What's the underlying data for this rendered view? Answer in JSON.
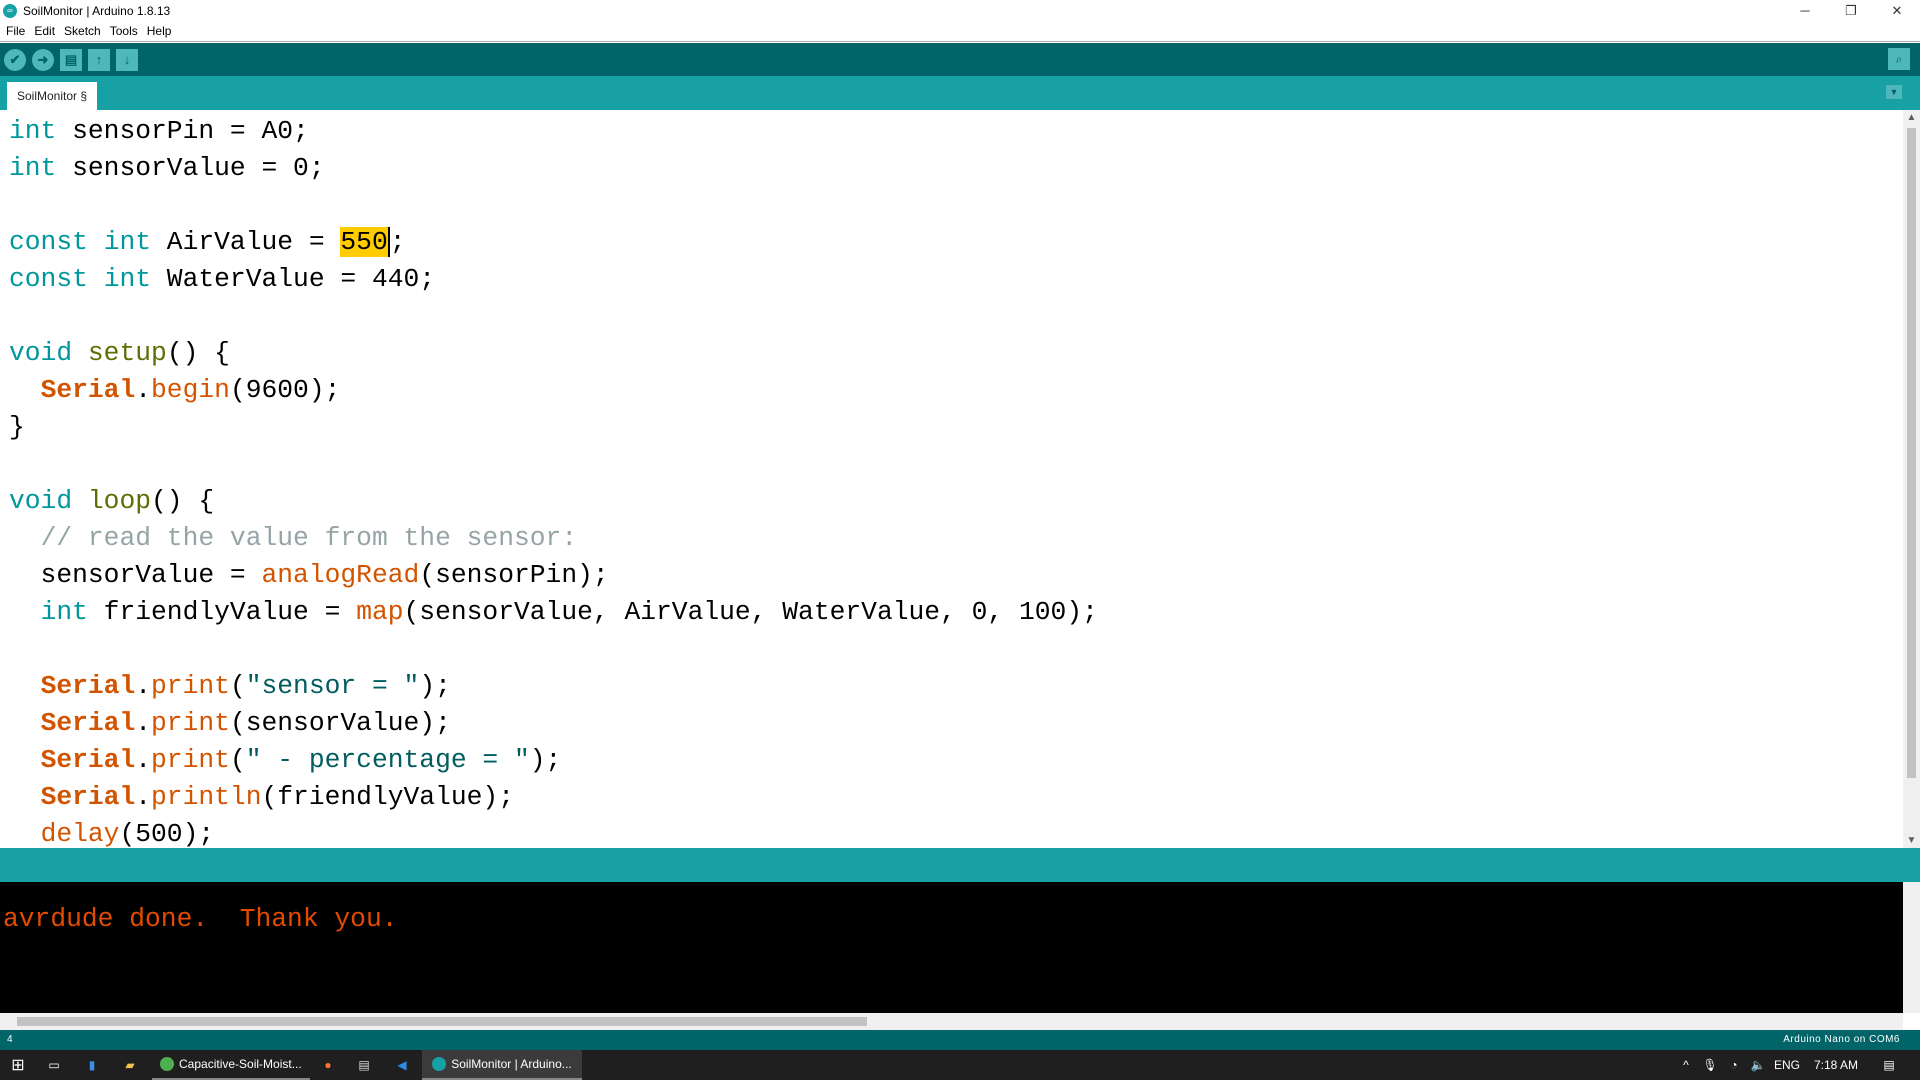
{
  "window": {
    "title": "SoilMonitor | Arduino 1.8.13",
    "controls": [
      "─",
      "❐",
      "✕"
    ]
  },
  "menu": [
    "File",
    "Edit",
    "Sketch",
    "Tools",
    "Help"
  ],
  "toolbar": {
    "buttons": [
      {
        "name": "verify",
        "icon": "✔"
      },
      {
        "name": "upload",
        "icon": "➜"
      },
      {
        "name": "new",
        "icon": "▤"
      },
      {
        "name": "open",
        "icon": "↑"
      },
      {
        "name": "save",
        "icon": "↓"
      }
    ],
    "serial_monitor_icon": "⌕"
  },
  "tab": {
    "label": "SoilMonitor §",
    "menu_icon": "▼"
  },
  "colors": {
    "teal_dark": "#006468",
    "teal": "#17a1a5",
    "keyword": "#00979c",
    "function": "#d35400",
    "string": "#005c5f",
    "comment": "#95a5a6",
    "highlight": "#ffcc00",
    "console_text": "#e34c00"
  },
  "code": [
    [
      [
        "int",
        "kw"
      ],
      [
        " sensorPin = A0;",
        ""
      ]
    ],
    [
      [
        "int",
        "kw"
      ],
      [
        " sensorValue = 0;",
        ""
      ]
    ],
    [],
    [
      [
        "const",
        "kw"
      ],
      [
        " ",
        ""
      ],
      [
        "int",
        "kw"
      ],
      [
        " AirValue = ",
        ""
      ],
      [
        "550",
        "hl caret"
      ],
      [
        ";",
        ""
      ]
    ],
    [
      [
        "const",
        "kw"
      ],
      [
        " ",
        ""
      ],
      [
        "int",
        "kw"
      ],
      [
        " WaterValue = 440;",
        ""
      ]
    ],
    [],
    [
      [
        "void",
        "kw"
      ],
      [
        " ",
        ""
      ],
      [
        "setup",
        "olive"
      ],
      [
        "() {",
        ""
      ]
    ],
    [
      [
        "  ",
        ""
      ],
      [
        "Serial",
        "cls"
      ],
      [
        ".",
        ""
      ],
      [
        "begin",
        "fn"
      ],
      [
        "(9600);",
        ""
      ]
    ],
    [
      [
        "}",
        ""
      ]
    ],
    [],
    [
      [
        "void",
        "kw"
      ],
      [
        " ",
        ""
      ],
      [
        "loop",
        "olive"
      ],
      [
        "() {",
        ""
      ]
    ],
    [
      [
        "  ",
        ""
      ],
      [
        "// read the value from the sensor:",
        "cm"
      ]
    ],
    [
      [
        "  sensorValue = ",
        ""
      ],
      [
        "analogRead",
        "fn"
      ],
      [
        "(sensorPin);",
        ""
      ]
    ],
    [
      [
        "  ",
        ""
      ],
      [
        "int",
        "kw"
      ],
      [
        " friendlyValue = ",
        ""
      ],
      [
        "map",
        "fn"
      ],
      [
        "(sensorValue, AirValue, WaterValue, 0, 100);",
        ""
      ]
    ],
    [],
    [
      [
        "  ",
        ""
      ],
      [
        "Serial",
        "cls"
      ],
      [
        ".",
        ""
      ],
      [
        "print",
        "fn"
      ],
      [
        "(",
        ""
      ],
      [
        "\"sensor = \"",
        "str"
      ],
      [
        ");",
        ""
      ]
    ],
    [
      [
        "  ",
        ""
      ],
      [
        "Serial",
        "cls"
      ],
      [
        ".",
        ""
      ],
      [
        "print",
        "fn"
      ],
      [
        "(sensorValue);",
        ""
      ]
    ],
    [
      [
        "  ",
        ""
      ],
      [
        "Serial",
        "cls"
      ],
      [
        ".",
        ""
      ],
      [
        "print",
        "fn"
      ],
      [
        "(",
        ""
      ],
      [
        "\" - percentage = \"",
        "str"
      ],
      [
        ");",
        ""
      ]
    ],
    [
      [
        "  ",
        ""
      ],
      [
        "Serial",
        "cls"
      ],
      [
        ".",
        ""
      ],
      [
        "println",
        "fn"
      ],
      [
        "(friendlyValue);",
        ""
      ]
    ],
    [
      [
        "  ",
        ""
      ],
      [
        "delay",
        "fn"
      ],
      [
        "(500);",
        ""
      ]
    ]
  ],
  "console": {
    "text": "avrdude done.  Thank you."
  },
  "status": {
    "line": "4",
    "board": "Arduino Nano on COM6"
  },
  "taskbar": {
    "apps": [
      {
        "label": "Capacitive-Soil-Moist..."
      },
      {
        "label": "SoilMonitor | Arduino..."
      }
    ],
    "tray": {
      "language": "ENG",
      "time": "7:18 AM"
    }
  }
}
